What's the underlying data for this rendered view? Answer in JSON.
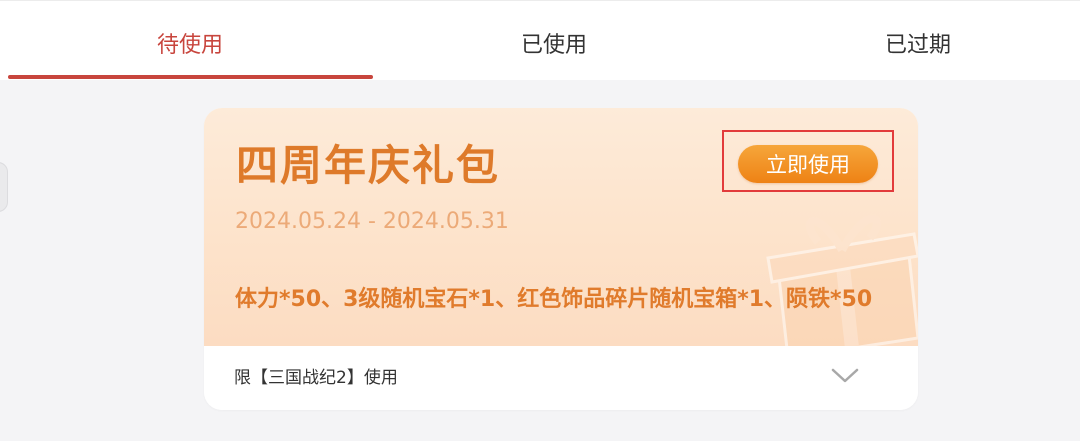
{
  "tabs": [
    {
      "label": "待使用",
      "active": true
    },
    {
      "label": "已使用",
      "active": false
    },
    {
      "label": "已过期",
      "active": false
    }
  ],
  "coupon": {
    "title": "四周年庆礼包",
    "date_range": "2024.05.24 - 2024.05.31",
    "button_label": "立即使用",
    "description": "体力*50、3级随机宝石*1、红色饰品碎片随机宝箱*1、陨铁*50",
    "limit_text": "限【三国战纪2】使用",
    "expand_icon": "chevron-down-icon"
  },
  "colors": {
    "accent": "#c8453d",
    "title_orange": "#de7a2a",
    "button_orange": "#ee8215",
    "highlight_red": "#e23b3b"
  }
}
